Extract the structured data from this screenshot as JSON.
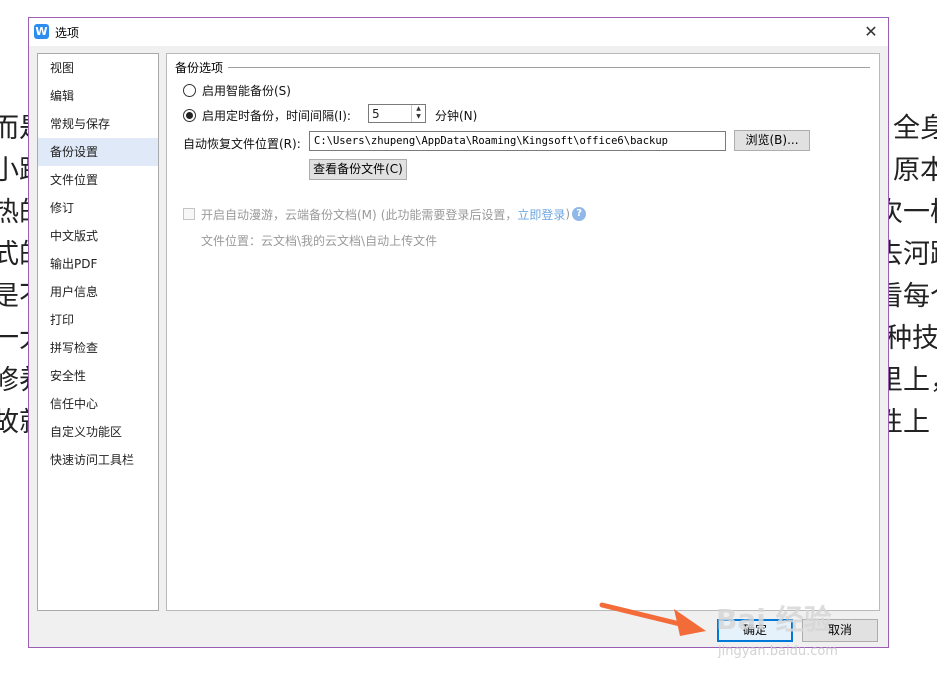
{
  "background_doc": {
    "left_lines": [
      "而是",
      "小跳",
      "热的",
      "式的",
      "是不",
      "一大",
      "修养",
      "故就"
    ],
    "right_lines": [
      "全身",
      "原本",
      "次一样",
      "去河踢",
      "看每个",
      "种技",
      "里上，",
      "性上"
    ]
  },
  "dialog": {
    "title": "选项",
    "app_icon": "W",
    "close_symbol": "✕"
  },
  "nav": {
    "items": [
      "视图",
      "编辑",
      "常规与保存",
      "备份设置",
      "文件位置",
      "修订",
      "中文版式",
      "输出PDF",
      "用户信息",
      "打印",
      "拼写检查",
      "安全性",
      "信任中心",
      "自定义功能区",
      "快速访问工具栏"
    ],
    "selected_index": 3
  },
  "backup": {
    "group_title": "备份选项",
    "smart_backup_label": "启用智能备份(S)",
    "timed_backup_label": "启用定时备份，时间间隔(I):",
    "interval_value": "5",
    "interval_unit": "分钟(N)",
    "selected_option": "timed",
    "autorecover_label": "自动恢复文件位置(R):",
    "autorecover_path": "C:\\Users\\zhupeng\\AppData\\Roaming\\Kingsoft\\office6\\backup",
    "browse_label": "浏览(B)...",
    "view_backup_label": "查看备份文件(C)",
    "roaming_label": "开启自动漫游，云端备份文档(M)",
    "roaming_note": "(此功能需要登录后设置，",
    "login_link": "立即登录",
    "roaming_note_end": ")",
    "roaming_path": "文件位置：云文档\\我的云文档\\自动上传文件"
  },
  "footer": {
    "ok_label": "确定",
    "cancel_label": "取消"
  },
  "watermark": {
    "main": "Bai 经验",
    "sub": "jingyan.baidu.com"
  },
  "colors": {
    "dialog_border": "#9a5fb4",
    "selection": "#dfe9f7",
    "ok_border": "#0078d7",
    "arrow": "#f46b3a",
    "link": "#6ea6e0"
  }
}
